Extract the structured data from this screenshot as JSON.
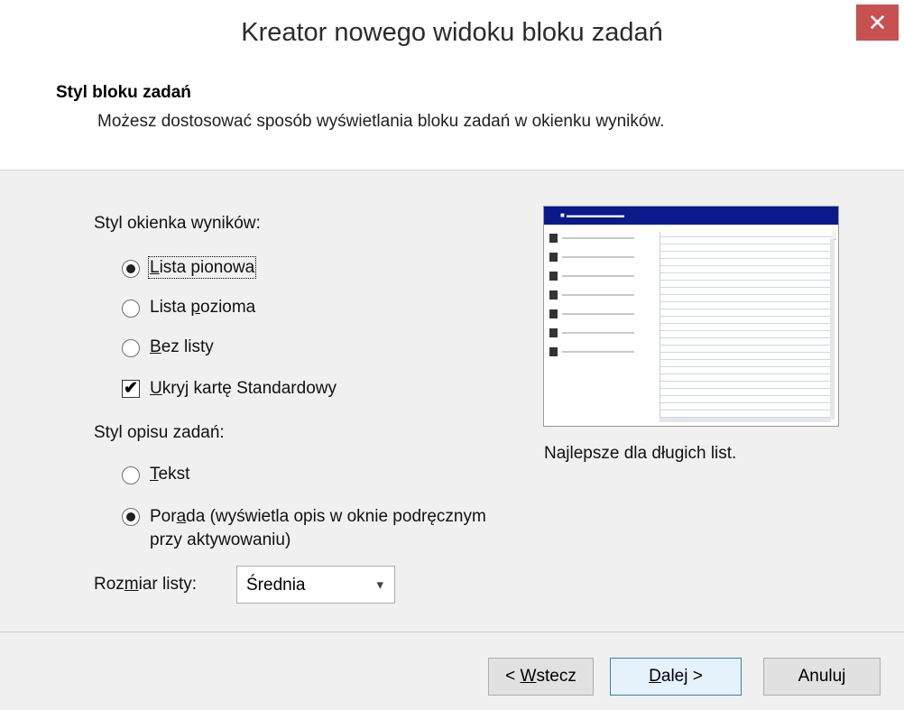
{
  "window": {
    "title": "Kreator nowego widoku bloku zadań",
    "close_glyph": "✕"
  },
  "header": {
    "title": "Styl bloku zadań",
    "subtitle": "Możesz dostosować sposób wyświetlania bloku zadań w okienku wyników."
  },
  "results_style": {
    "label": "Styl okienka wyników:",
    "options": [
      {
        "before": "",
        "accel": "L",
        "after": "ista pionowa",
        "selected": true
      },
      {
        "before": "Lista ",
        "accel": "p",
        "after": "ozioma",
        "selected": false
      },
      {
        "before": "",
        "accel": "B",
        "after": "ez listy",
        "selected": false
      }
    ],
    "hide_tab": {
      "before": "",
      "accel": "U",
      "after": "kryj kartę Standardowy",
      "checked": true
    }
  },
  "description_style": {
    "label": "Styl opisu zadań:",
    "options": [
      {
        "before": "",
        "accel": "T",
        "after": "ekst",
        "selected": false
      },
      {
        "before": "Por",
        "accel": "a",
        "after": "da (wyświetla opis w oknie podręcznym",
        "line2": "przy aktywowaniu)",
        "selected": true
      }
    ]
  },
  "list_size": {
    "before": "Roz",
    "accel": "m",
    "after": "iar listy:",
    "value": "Średnia"
  },
  "preview": {
    "caption": "Najlepsze dla długich list.",
    "icon": "window-preview-icon"
  },
  "buttons": {
    "back": {
      "before": "< ",
      "accel": "W",
      "after": "stecz"
    },
    "next": {
      "before": "",
      "accel": "D",
      "after": "alej >"
    },
    "cancel": {
      "label": "Anuluj"
    }
  },
  "colors": {
    "close": "#c75050",
    "preview_titlebar": "#0a1a8a",
    "primary_border": "#3c7fb1"
  }
}
